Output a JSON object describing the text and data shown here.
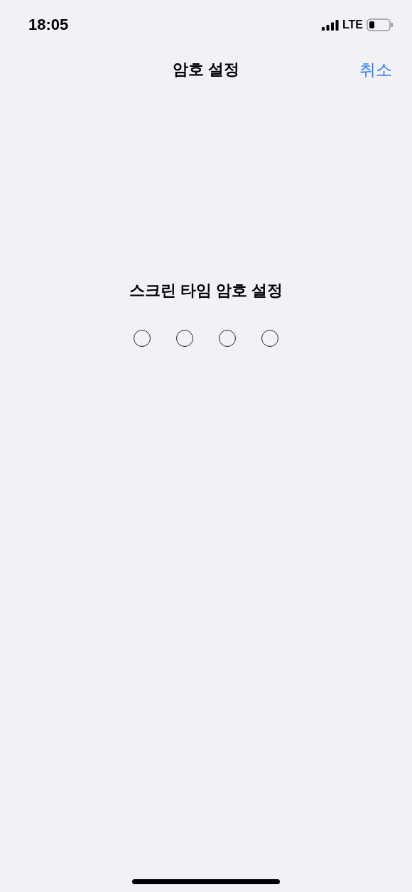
{
  "status_bar": {
    "time": "18:05",
    "network": "LTE"
  },
  "nav_bar": {
    "title": "암호 설정",
    "cancel": "취소"
  },
  "prompt": "스크린 타임 암호 설정",
  "passcode_dots": [
    {
      "filled": false
    },
    {
      "filled": false
    },
    {
      "filled": false
    },
    {
      "filled": false
    }
  ]
}
